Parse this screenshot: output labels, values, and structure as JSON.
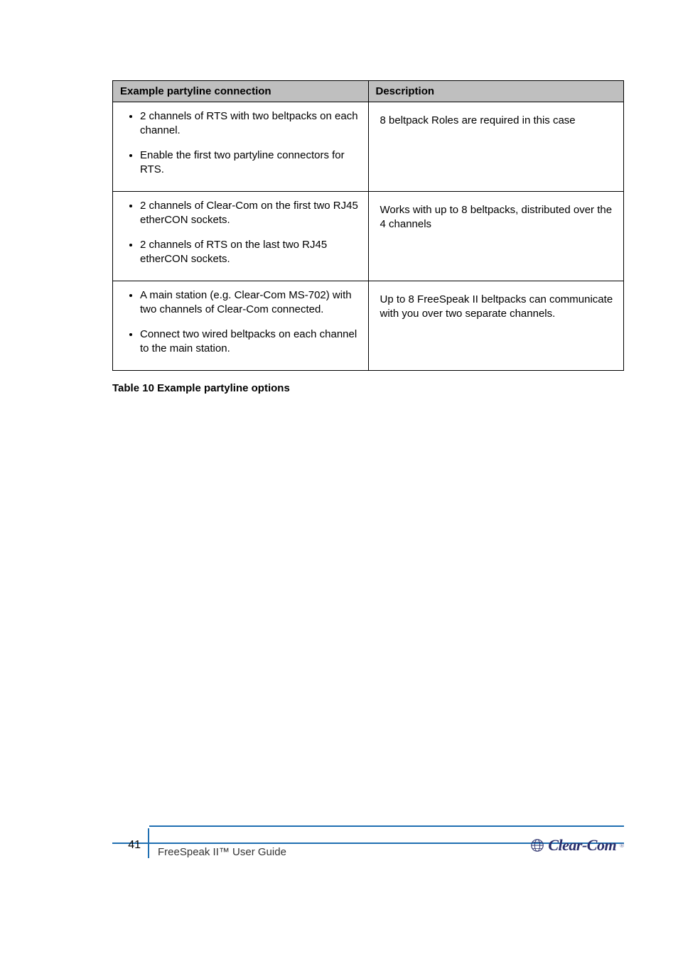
{
  "table": {
    "headers": [
      "Example partyline connection",
      "Description"
    ],
    "rows": [
      {
        "left": [
          "2 channels of RTS with two beltpacks on each channel.",
          "Enable the first two partyline connectors for RTS."
        ],
        "right": "8 beltpack Roles are required in this case"
      },
      {
        "left": [
          "2 channels of Clear-Com on the first two RJ45 etherCON sockets.",
          "2 channels of RTS on the last two RJ45 etherCON sockets."
        ],
        "right": "Works with up to 8 beltpacks, distributed over the 4 channels"
      },
      {
        "left": [
          "A main station (e.g. Clear-Com MS-702) with two channels of Clear-Com connected.",
          "Connect two wired beltpacks on each channel to the main station."
        ],
        "right": "Up to 8 FreeSpeak II beltpacks can communicate with you over two separate channels."
      }
    ]
  },
  "caption": "Table 10 Example partyline options",
  "footer": {
    "page": "41",
    "text": "FreeSpeak II™ User Guide",
    "logo": "Clear-Com",
    "reg": "®"
  }
}
